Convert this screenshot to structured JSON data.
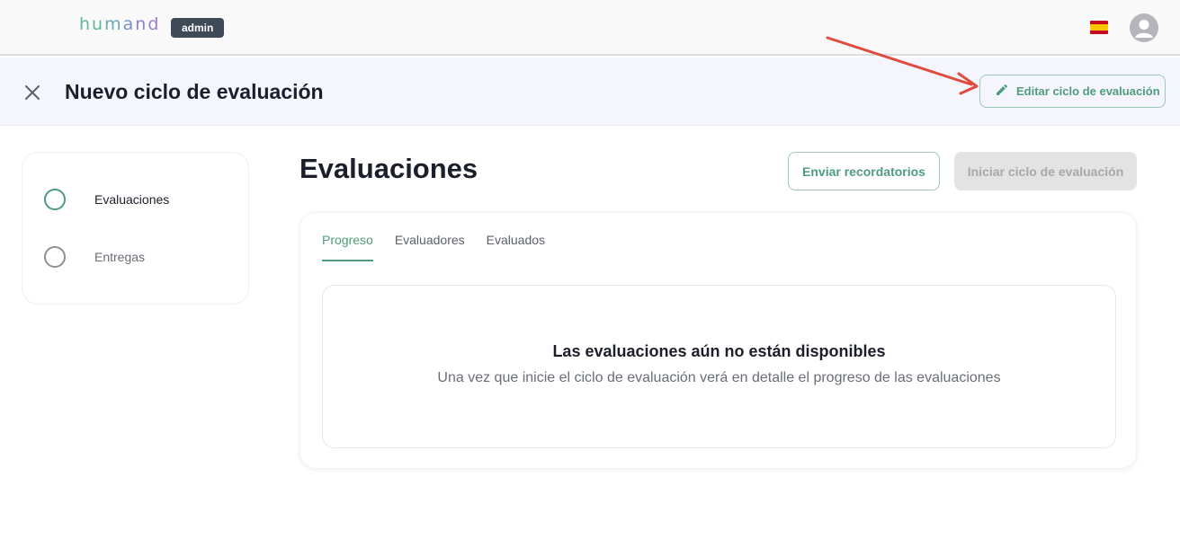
{
  "header": {
    "logo_letters": [
      "h",
      "u",
      "m",
      "a",
      "n",
      "d"
    ],
    "logo_colors": [
      "#5fb89a",
      "#5fb89a",
      "#6ba7b8",
      "#7a92c4",
      "#8a83c9",
      "#9a7dc6"
    ],
    "badge": "admin",
    "language_flag": "spain-flag-icon",
    "avatar_icon": "user-avatar-icon"
  },
  "subheader": {
    "title": "Nuevo ciclo de evaluación",
    "close_icon": "close-icon",
    "edit_button": {
      "label": "Editar ciclo de evaluación",
      "icon": "pencil-icon"
    }
  },
  "stepper": {
    "steps": [
      {
        "label": "Evaluaciones",
        "active": true
      },
      {
        "label": "Entregas",
        "active": false
      }
    ]
  },
  "main": {
    "title": "Evaluaciones",
    "reminders_button": "Enviar recordatorios",
    "start_button": "Iniciar ciclo de evaluación",
    "tabs": [
      {
        "label": "Progreso",
        "active": true
      },
      {
        "label": "Evaluadores",
        "active": false
      },
      {
        "label": "Evaluados",
        "active": false
      }
    ],
    "empty_state": {
      "title": "Las evaluaciones aún no están disponibles",
      "description": "Una vez que inicie el ciclo de evaluación verá en detalle el progreso de las evaluaciones"
    }
  },
  "colors": {
    "accent": "#4e9c7c",
    "annotation_arrow": "#e04b3f"
  }
}
